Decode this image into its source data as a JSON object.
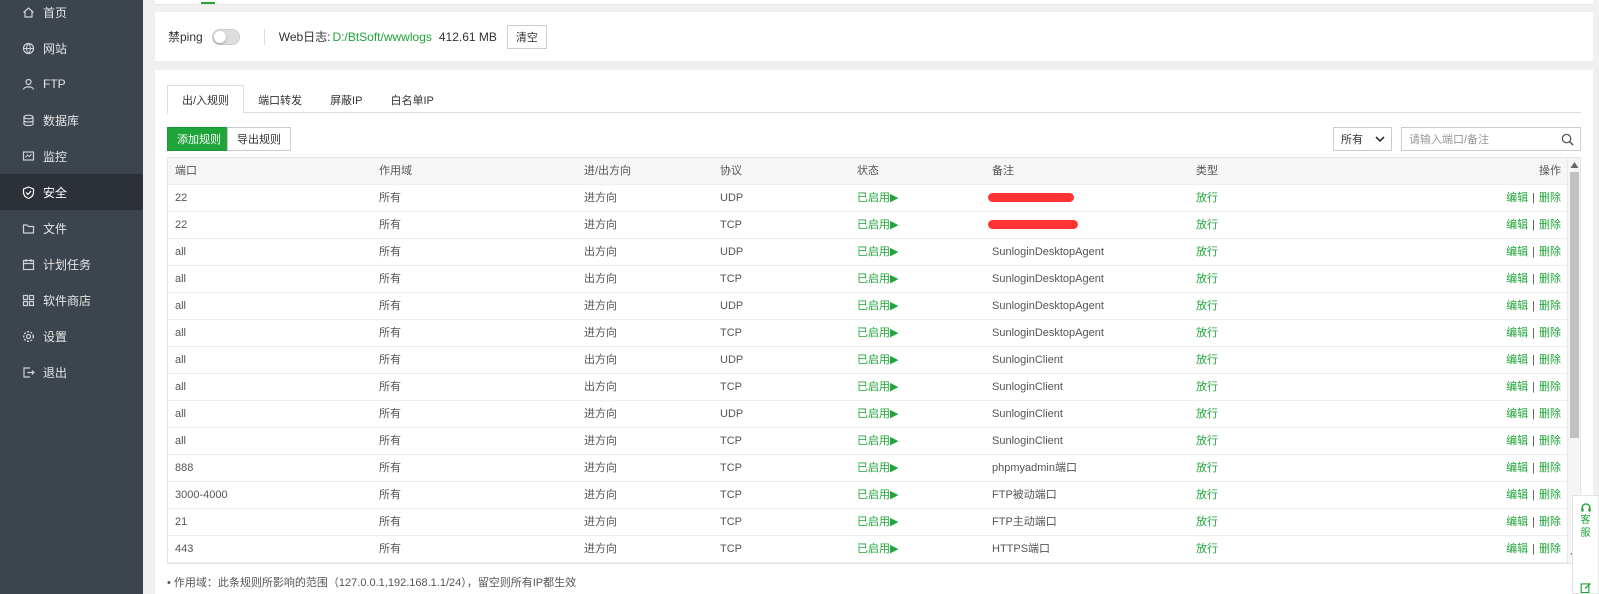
{
  "sidebar": {
    "items": [
      {
        "label": "首页",
        "icon": "home-icon"
      },
      {
        "label": "网站",
        "icon": "globe-icon"
      },
      {
        "label": "FTP",
        "icon": "ftp-icon"
      },
      {
        "label": "数据库",
        "icon": "database-icon"
      },
      {
        "label": "监控",
        "icon": "monitor-icon"
      },
      {
        "label": "安全",
        "icon": "shield-icon"
      },
      {
        "label": "文件",
        "icon": "folder-icon"
      },
      {
        "label": "计划任务",
        "icon": "calendar-icon"
      },
      {
        "label": "软件商店",
        "icon": "grid-icon"
      },
      {
        "label": "设置",
        "icon": "gear-icon"
      },
      {
        "label": "退出",
        "icon": "logout-icon"
      }
    ],
    "active_index": 5
  },
  "settings": {
    "ping_label": "禁ping",
    "weblog_label": "Web日志:",
    "weblog_path": "D:/BtSoft/wwwlogs",
    "weblog_size": "412.61 MB",
    "clear_label": "清空"
  },
  "tabs": [
    "出/入规则",
    "端口转发",
    "屏蔽IP",
    "白名单IP"
  ],
  "toolbar": {
    "add_label": "添加规则",
    "export_label": "导出规则",
    "filter_value": "所有",
    "search_placeholder": "请输入端口/备注"
  },
  "table": {
    "headers": {
      "port": "端口",
      "scope": "作用域",
      "direction": "进/出方向",
      "protocol": "协议",
      "status": "状态",
      "note": "备注",
      "type": "类型",
      "ops": "操作"
    },
    "edit_label": "编辑",
    "delete_label": "删除",
    "sep": "|",
    "rows": [
      {
        "port": "22",
        "scope": "所有",
        "direction": "进方向",
        "protocol": "UDP",
        "status": "已启用▶",
        "note": "",
        "type": "放行",
        "redacted": true
      },
      {
        "port": "22",
        "scope": "所有",
        "direction": "进方向",
        "protocol": "TCP",
        "status": "已启用▶",
        "note": "",
        "type": "放行",
        "redacted": true
      },
      {
        "port": "all",
        "scope": "所有",
        "direction": "出方向",
        "protocol": "UDP",
        "status": "已启用▶",
        "note": "SunloginDesktopAgent",
        "type": "放行"
      },
      {
        "port": "all",
        "scope": "所有",
        "direction": "出方向",
        "protocol": "TCP",
        "status": "已启用▶",
        "note": "SunloginDesktopAgent",
        "type": "放行"
      },
      {
        "port": "all",
        "scope": "所有",
        "direction": "进方向",
        "protocol": "UDP",
        "status": "已启用▶",
        "note": "SunloginDesktopAgent",
        "type": "放行"
      },
      {
        "port": "all",
        "scope": "所有",
        "direction": "进方向",
        "protocol": "TCP",
        "status": "已启用▶",
        "note": "SunloginDesktopAgent",
        "type": "放行"
      },
      {
        "port": "all",
        "scope": "所有",
        "direction": "出方向",
        "protocol": "UDP",
        "status": "已启用▶",
        "note": "SunloginClient",
        "type": "放行"
      },
      {
        "port": "all",
        "scope": "所有",
        "direction": "出方向",
        "protocol": "TCP",
        "status": "已启用▶",
        "note": "SunloginClient",
        "type": "放行"
      },
      {
        "port": "all",
        "scope": "所有",
        "direction": "进方向",
        "protocol": "UDP",
        "status": "已启用▶",
        "note": "SunloginClient",
        "type": "放行"
      },
      {
        "port": "all",
        "scope": "所有",
        "direction": "进方向",
        "protocol": "TCP",
        "status": "已启用▶",
        "note": "SunloginClient",
        "type": "放行"
      },
      {
        "port": "888",
        "scope": "所有",
        "direction": "进方向",
        "protocol": "TCP",
        "status": "已启用▶",
        "note": "phpmyadmin端口",
        "type": "放行"
      },
      {
        "port": "3000-4000",
        "scope": "所有",
        "direction": "进方向",
        "protocol": "TCP",
        "status": "已启用▶",
        "note": "FTP被动端口",
        "type": "放行"
      },
      {
        "port": "21",
        "scope": "所有",
        "direction": "进方向",
        "protocol": "TCP",
        "status": "已启用▶",
        "note": "FTP主动端口",
        "type": "放行"
      },
      {
        "port": "443",
        "scope": "所有",
        "direction": "进方向",
        "protocol": "TCP",
        "status": "已启用▶",
        "note": "HTTPS端口",
        "type": "放行"
      }
    ]
  },
  "footnote": "•  作用域：此条规则所影响的范围（127.0.0.1,192.168.1.1/24），留空则所有IP都生效",
  "float_help": {
    "label": "客服"
  },
  "colors": {
    "accent": "#20a53a",
    "sidebar": "#3c444d",
    "redact": "#ff3333"
  }
}
